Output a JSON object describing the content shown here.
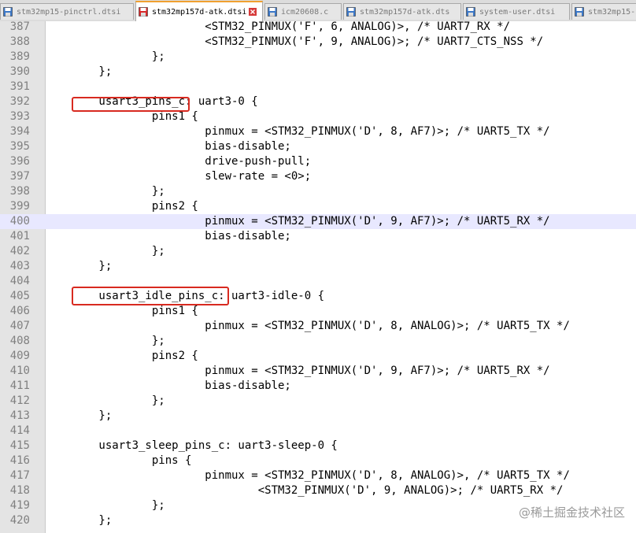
{
  "tabs": [
    {
      "label": "stm32mp15-pinctrl.dtsi",
      "icon": "file-saved-icon",
      "active": false
    },
    {
      "label": "stm32mp157d-atk.dtsi",
      "icon": "file-modified-icon",
      "active": true
    },
    {
      "label": "icm20608.c",
      "icon": "file-saved-icon",
      "active": false
    },
    {
      "label": "stm32mp157d-atk.dts",
      "icon": "file-saved-icon",
      "active": false
    },
    {
      "label": "system-user.dtsi",
      "icon": "file-saved-icon",
      "active": false
    },
    {
      "label": "stm32mp15-",
      "icon": "file-saved-icon",
      "active": false
    }
  ],
  "editor": {
    "current_line": "400",
    "lines": [
      {
        "n": "387",
        "t": "                        <STM32_PINMUX('F', 6, ANALOG)>, /* UART7_RX */"
      },
      {
        "n": "388",
        "t": "                        <STM32_PINMUX('F', 9, ANALOG)>; /* UART7_CTS_NSS */"
      },
      {
        "n": "389",
        "t": "                };"
      },
      {
        "n": "390",
        "t": "        };"
      },
      {
        "n": "391",
        "t": ""
      },
      {
        "n": "392",
        "t": "        usart3_pins_c: uart3-0 {"
      },
      {
        "n": "393",
        "t": "                pins1 {"
      },
      {
        "n": "394",
        "t": "                        pinmux = <STM32_PINMUX('D', 8, AF7)>; /* UART5_TX */"
      },
      {
        "n": "395",
        "t": "                        bias-disable;"
      },
      {
        "n": "396",
        "t": "                        drive-push-pull;"
      },
      {
        "n": "397",
        "t": "                        slew-rate = <0>;"
      },
      {
        "n": "398",
        "t": "                };"
      },
      {
        "n": "399",
        "t": "                pins2 {"
      },
      {
        "n": "400",
        "t": "                        pinmux = <STM32_PINMUX('D', 9, AF7)>; /* UART5_RX */"
      },
      {
        "n": "401",
        "t": "                        bias-disable;"
      },
      {
        "n": "402",
        "t": "                };"
      },
      {
        "n": "403",
        "t": "        };"
      },
      {
        "n": "404",
        "t": ""
      },
      {
        "n": "405",
        "t": "        usart3_idle_pins_c: uart3-idle-0 {"
      },
      {
        "n": "406",
        "t": "                pins1 {"
      },
      {
        "n": "407",
        "t": "                        pinmux = <STM32_PINMUX('D', 8, ANALOG)>; /* UART5_TX */"
      },
      {
        "n": "408",
        "t": "                };"
      },
      {
        "n": "409",
        "t": "                pins2 {"
      },
      {
        "n": "410",
        "t": "                        pinmux = <STM32_PINMUX('D', 9, AF7)>; /* UART5_RX */"
      },
      {
        "n": "411",
        "t": "                        bias-disable;"
      },
      {
        "n": "412",
        "t": "                };"
      },
      {
        "n": "413",
        "t": "        };"
      },
      {
        "n": "414",
        "t": ""
      },
      {
        "n": "415",
        "t": "        usart3_sleep_pins_c: uart3-sleep-0 {"
      },
      {
        "n": "416",
        "t": "                pins {"
      },
      {
        "n": "417",
        "t": "                        pinmux = <STM32_PINMUX('D', 8, ANALOG)>, /* UART5_TX */"
      },
      {
        "n": "418",
        "t": "                                <STM32_PINMUX('D', 9, ANALOG)>; /* UART5_RX */"
      },
      {
        "n": "419",
        "t": "                };"
      },
      {
        "n": "420",
        "t": "        };"
      }
    ]
  },
  "highlight_color": "#d82a20",
  "watermark": "@稀土掘金技术社区"
}
